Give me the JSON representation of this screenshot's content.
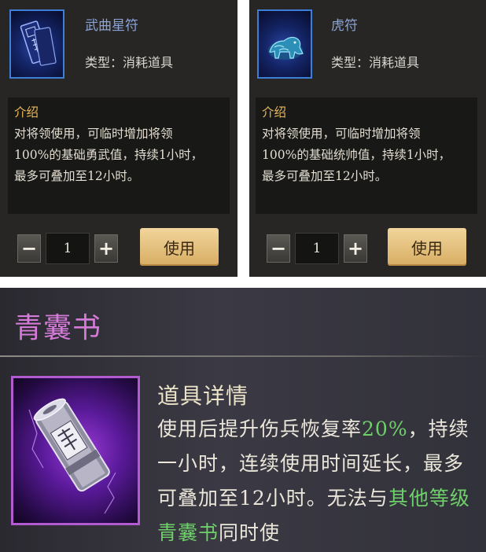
{
  "items": [
    {
      "name": "武曲星符",
      "type_label": "类型：消耗道具",
      "desc_title": "介绍",
      "desc_lines": [
        "对将领使用，可临时增加将领",
        "100%的基础勇武值，持续1小时，",
        "最多可叠加至12小时。"
      ],
      "quantity": "1",
      "minus_label": "−",
      "plus_label": "+",
      "use_label": "使用",
      "icon": "talisman-card-icon"
    },
    {
      "name": "虎符",
      "type_label": "类型：消耗道具",
      "desc_title": "介绍",
      "desc_lines": [
        "对将领使用，可临时增加将领",
        "100%的基础统帅值，持续1小时，",
        "最多可叠加至12小时。"
      ],
      "quantity": "1",
      "minus_label": "−",
      "plus_label": "+",
      "use_label": "使用",
      "icon": "tiger-tally-icon"
    }
  ],
  "book": {
    "title": "青囊书",
    "detail_title": "道具详情",
    "detail_parts": [
      "使用后提升伤兵恢复率",
      "20%",
      "，持续一小时，连续使用时间延长，最多可叠加至12小时。无法与",
      "其他等级青囊书",
      "同时使"
    ],
    "icon": "scroll-book-icon"
  },
  "colors": {
    "item_name": "#8aa3d8",
    "use_button": "#e8c27c",
    "book_title": "#d47bd8",
    "highlight_green": "#6fcf6a",
    "blue_frame": "#3d7fd6",
    "purple_frame": "#b25ad0"
  }
}
